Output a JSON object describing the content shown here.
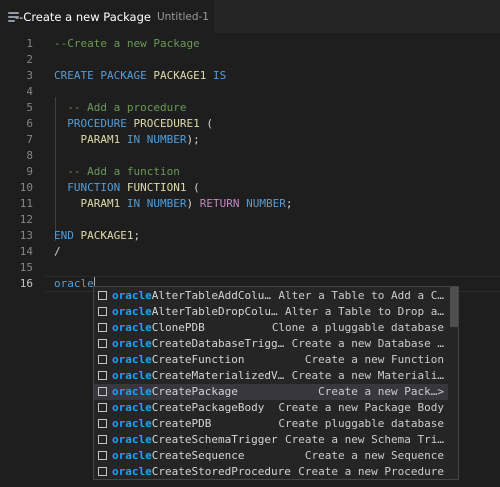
{
  "tab": {
    "title": "--Create a new Package",
    "description": "Untitled-1",
    "icon": "file-lines-icon"
  },
  "editor": {
    "lines": [
      {
        "n": "1",
        "tokens": [
          [
            "cmt",
            "--Create a new Package"
          ]
        ]
      },
      {
        "n": "2",
        "tokens": []
      },
      {
        "n": "3",
        "tokens": [
          [
            "kw",
            "CREATE PACKAGE "
          ],
          [
            "id",
            "PACKAGE1"
          ],
          [
            "kw",
            " IS"
          ]
        ]
      },
      {
        "n": "4",
        "tokens": []
      },
      {
        "n": "5",
        "tokens": [
          [
            "pl",
            "  "
          ],
          [
            "cmt",
            "-- Add a procedure"
          ]
        ]
      },
      {
        "n": "6",
        "tokens": [
          [
            "pl",
            "  "
          ],
          [
            "kw",
            "PROCEDURE "
          ],
          [
            "id",
            "PROCEDURE1"
          ],
          [
            "pl",
            " ("
          ]
        ]
      },
      {
        "n": "7",
        "tokens": [
          [
            "pl",
            "    "
          ],
          [
            "id",
            "PARAM1"
          ],
          [
            "kw",
            " IN NUMBER"
          ],
          [
            "pl",
            ");"
          ]
        ]
      },
      {
        "n": "8",
        "tokens": []
      },
      {
        "n": "9",
        "tokens": [
          [
            "pl",
            "  "
          ],
          [
            "cmt",
            "-- Add a function"
          ]
        ]
      },
      {
        "n": "10",
        "tokens": [
          [
            "pl",
            "  "
          ],
          [
            "kw",
            "FUNCTION "
          ],
          [
            "id",
            "FUNCTION1"
          ],
          [
            "pl",
            " ("
          ]
        ]
      },
      {
        "n": "11",
        "tokens": [
          [
            "pl",
            "    "
          ],
          [
            "id",
            "PARAM1"
          ],
          [
            "kw",
            " IN NUMBER"
          ],
          [
            "pl",
            ") "
          ],
          [
            "ret",
            "RETURN"
          ],
          [
            "kw",
            " NUMBER"
          ],
          [
            "pl",
            ";"
          ]
        ]
      },
      {
        "n": "12",
        "tokens": []
      },
      {
        "n": "13",
        "tokens": [
          [
            "kw",
            "END "
          ],
          [
            "id",
            "PACKAGE1"
          ],
          [
            "pl",
            ";"
          ]
        ]
      },
      {
        "n": "14",
        "tokens": [
          [
            "pl",
            "/"
          ]
        ]
      },
      {
        "n": "15",
        "tokens": []
      },
      {
        "n": "16",
        "tokens": [
          [
            "kw",
            "oracle"
          ]
        ],
        "active": true
      }
    ]
  },
  "suggest": {
    "prefix": "oracle",
    "selected_index": 6,
    "items": [
      {
        "rest": "AlterTableAddColu…",
        "detail": "Alter a Table to Add a C…"
      },
      {
        "rest": "AlterTableDropColu…",
        "detail": "Alter a Table to Drop a…"
      },
      {
        "rest": "ClonePDB",
        "detail": "Clone a pluggable database"
      },
      {
        "rest": "CreateDatabaseTrigg…",
        "detail": "Create a new Database …"
      },
      {
        "rest": "CreateFunction",
        "detail": "Create a new Function"
      },
      {
        "rest": "CreateMaterializedV…",
        "detail": "Create a new Materiali…"
      },
      {
        "rest": "CreatePackage",
        "detail": "Create a new Pack…>"
      },
      {
        "rest": "CreatePackageBody",
        "detail": "Create a new Package Body"
      },
      {
        "rest": "CreatePDB",
        "detail": "Create pluggable database"
      },
      {
        "rest": "CreateSchemaTrigger",
        "detail": "Create a new Schema Tri…"
      },
      {
        "rest": "CreateSequence",
        "detail": "Create a new Sequence"
      },
      {
        "rest": "CreateStoredProcedure",
        "detail": "Create a new Procedure"
      }
    ]
  }
}
